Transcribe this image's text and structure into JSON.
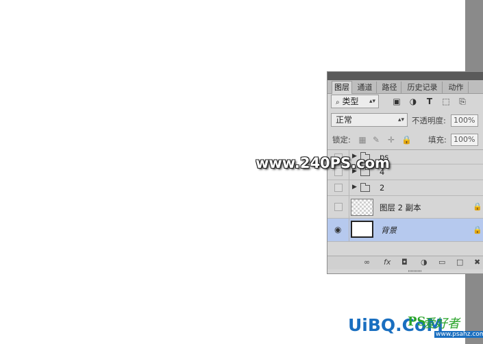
{
  "tabs": [
    {
      "label": "图层",
      "active": true
    },
    {
      "label": "通道",
      "active": false
    },
    {
      "label": "路径",
      "active": false
    },
    {
      "label": "历史记录",
      "active": false
    },
    {
      "label": "动作",
      "active": false
    }
  ],
  "filter": {
    "kind_label": "类型",
    "kind_icon": "search-icon"
  },
  "blend": {
    "mode": "正常",
    "opacity_label": "不透明度:",
    "opacity_value": "100%"
  },
  "lock": {
    "label": "锁定:",
    "fill_label": "填充:",
    "fill_value": "100%"
  },
  "layers": [
    {
      "name": "ps",
      "type": "group",
      "visible": false
    },
    {
      "name": "4",
      "type": "group",
      "visible": false
    },
    {
      "name": "2",
      "type": "group",
      "visible": false
    },
    {
      "name": "图层 2 副本",
      "type": "pixel",
      "visible": false,
      "locked": true
    },
    {
      "name": "背景",
      "type": "background",
      "visible": true,
      "locked": true,
      "selected": true
    }
  ],
  "watermark": "www.240PS.com",
  "logo": {
    "main": "UiBQ.CoM",
    "ps": "PS",
    "cn": "爱好者",
    "site": "www.psahz.com"
  },
  "colors": {
    "selected_layer": "#b6c9ee",
    "panel": "#d6d6d6",
    "logo_blue": "#1a6fc0",
    "logo_green": "#2aa42a"
  }
}
